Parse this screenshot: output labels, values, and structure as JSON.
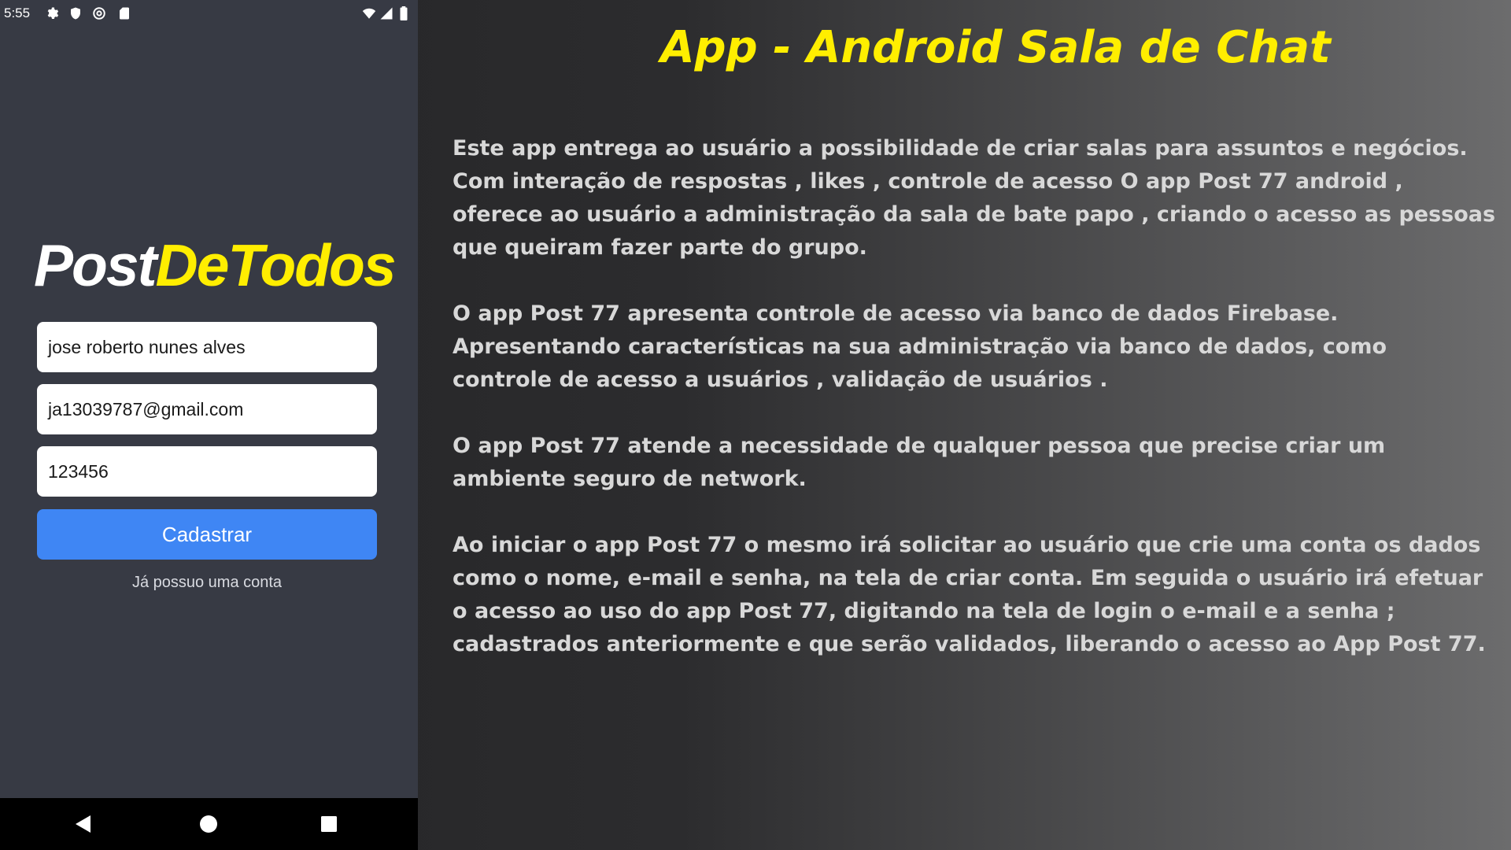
{
  "status_bar": {
    "time": "5:55",
    "left_icons": [
      "gear-icon",
      "shield-icon",
      "at-sign-icon",
      "sd-card-icon"
    ],
    "right_icons": [
      "wifi-icon",
      "cell-signal-icon",
      "battery-icon"
    ]
  },
  "app": {
    "logo_part1": "Post",
    "logo_part2": "DeTodos",
    "fields": {
      "name_value": "jose roberto nunes alves",
      "email_value": "ja13039787@gmail.com",
      "password_value": "123456"
    },
    "register_button": "Cadastrar",
    "login_link": "Já possuo uma conta"
  },
  "nav_bar": [
    "back-icon",
    "home-icon",
    "recents-icon"
  ],
  "description": {
    "title": "App - Android Sala de Chat",
    "paragraphs": [
      [
        "Este app entrega ao usuário a possibilidade de criar salas para assuntos e negócios.",
        "Com interação de respostas , likes , controle de acesso  O app Post  77 android ,",
        "oferece ao usuário a administração da sala de bate papo , criando o acesso as pessoas",
        "que queiram fazer parte do grupo."
      ],
      [
        "O app Post 77 apresenta controle de acesso via banco de dados Firebase.",
        "Apresentando características na sua administração via banco de dados, como",
        "controle de acesso a usuários , validação de usuários ."
      ],
      [
        "O app Post 77 atende a necessidade de qualquer pessoa que precise criar um",
        "ambiente seguro de network."
      ],
      [
        "Ao iniciar o app Post 77 o mesmo irá solicitar ao usuário que crie uma conta os dados",
        "como o nome, e-mail e senha, na tela de criar conta.  Em seguida o usuário irá efetuar",
        "o acesso ao uso do app Post 77, digitando na tela de login o e-mail e a senha ;",
        "cadastrados anteriormente e que serão validados, liberando o acesso ao App Post 77."
      ]
    ]
  },
  "colors": {
    "phone_background": "#373a44",
    "accent_yellow": "#ffee00",
    "button_blue": "#3f86f4"
  }
}
